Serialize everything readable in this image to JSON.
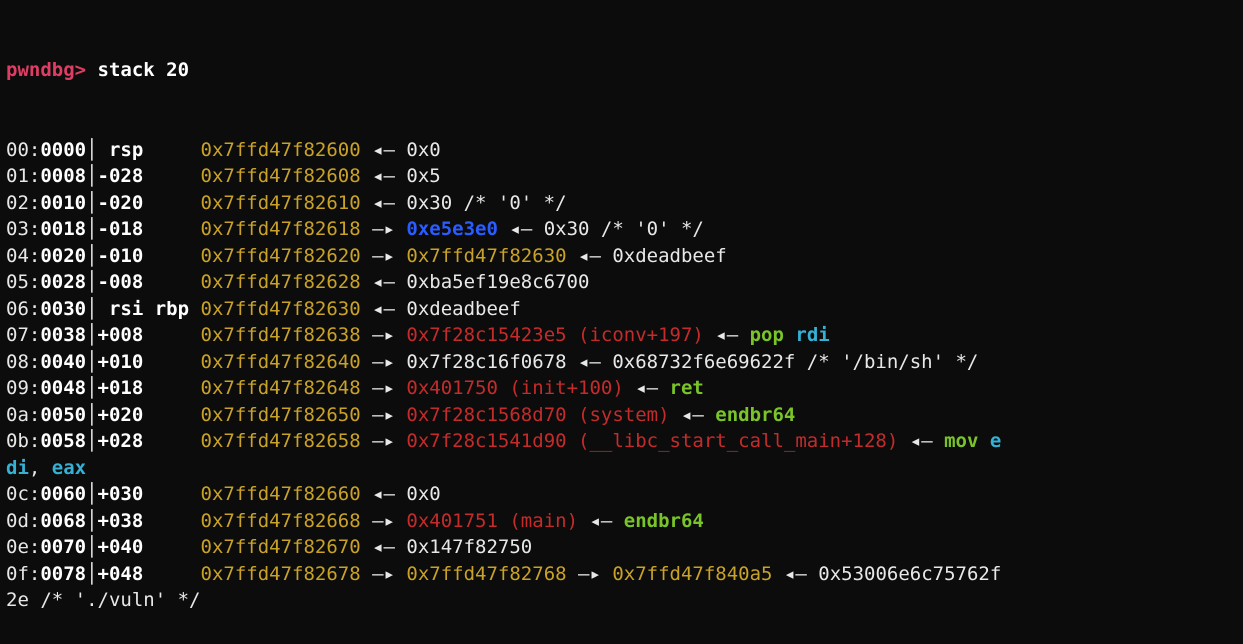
{
  "prompt": "pwndbg>",
  "command": " stack 20",
  "rows": [
    {
      "idx": "00:",
      "off": "0000",
      "delta": " rsp    ",
      "segs": [
        {
          "cls": "c-address",
          "t": " 0x7ffd47f82600"
        },
        {
          "cls": "c-white",
          "t": " ◂— 0x0"
        }
      ]
    },
    {
      "idx": "01:",
      "off": "0008",
      "delta": "-028    ",
      "segs": [
        {
          "cls": "c-address",
          "t": " 0x7ffd47f82608"
        },
        {
          "cls": "c-white",
          "t": " ◂— 0x5"
        }
      ]
    },
    {
      "idx": "02:",
      "off": "0010",
      "delta": "-020    ",
      "segs": [
        {
          "cls": "c-address",
          "t": " 0x7ffd47f82610"
        },
        {
          "cls": "c-white",
          "t": " ◂— 0x30 /* '0' */"
        }
      ]
    },
    {
      "idx": "03:",
      "off": "0018",
      "delta": "-018    ",
      "segs": [
        {
          "cls": "c-address",
          "t": " 0x7ffd47f82618"
        },
        {
          "cls": "c-white",
          "t": " —▸ "
        },
        {
          "cls": "c-blue",
          "t": "0xe5e3e0"
        },
        {
          "cls": "c-white",
          "t": " ◂— 0x30 /* '0' */"
        }
      ]
    },
    {
      "idx": "04:",
      "off": "0020",
      "delta": "-010    ",
      "segs": [
        {
          "cls": "c-address",
          "t": " 0x7ffd47f82620"
        },
        {
          "cls": "c-white",
          "t": " —▸ "
        },
        {
          "cls": "c-address",
          "t": "0x7ffd47f82630"
        },
        {
          "cls": "c-white",
          "t": " ◂— 0xdeadbeef"
        }
      ]
    },
    {
      "idx": "05:",
      "off": "0028",
      "delta": "-008    ",
      "segs": [
        {
          "cls": "c-address",
          "t": " 0x7ffd47f82628"
        },
        {
          "cls": "c-white",
          "t": " ◂— 0xba5ef19e8c6700"
        }
      ]
    },
    {
      "idx": "06:",
      "off": "0030",
      "delta": " rsi rbp",
      "segs": [
        {
          "cls": "c-address",
          "t": " 0x7ffd47f82630"
        },
        {
          "cls": "c-white",
          "t": " ◂— 0xdeadbeef"
        }
      ]
    },
    {
      "idx": "07:",
      "off": "0038",
      "delta": "+008    ",
      "segs": [
        {
          "cls": "c-address",
          "t": " 0x7ffd47f82638"
        },
        {
          "cls": "c-white",
          "t": " —▸ "
        },
        {
          "cls": "c-red",
          "t": "0x7f28c15423e5 (iconv+197)"
        },
        {
          "cls": "c-white",
          "t": " ◂— "
        },
        {
          "cls": "c-green",
          "t": "pop "
        },
        {
          "cls": "c-cyan",
          "t": "rdi"
        }
      ]
    },
    {
      "idx": "08:",
      "off": "0040",
      "delta": "+010    ",
      "segs": [
        {
          "cls": "c-address",
          "t": " 0x7ffd47f82640"
        },
        {
          "cls": "c-white",
          "t": " —▸ 0x7f28c16f0678 ◂— 0x68732f6e69622f /* '/bin/sh' */"
        }
      ]
    },
    {
      "idx": "09:",
      "off": "0048",
      "delta": "+018    ",
      "segs": [
        {
          "cls": "c-address",
          "t": " 0x7ffd47f82648"
        },
        {
          "cls": "c-white",
          "t": " —▸ "
        },
        {
          "cls": "c-red",
          "t": "0x401750 (init+100)"
        },
        {
          "cls": "c-white",
          "t": " ◂— "
        },
        {
          "cls": "c-green",
          "t": "ret"
        }
      ]
    },
    {
      "idx": "0a:",
      "off": "0050",
      "delta": "+020    ",
      "segs": [
        {
          "cls": "c-address",
          "t": " 0x7ffd47f82650"
        },
        {
          "cls": "c-white",
          "t": " —▸ "
        },
        {
          "cls": "c-red",
          "t": "0x7f28c1568d70 (system)"
        },
        {
          "cls": "c-white",
          "t": " ◂— "
        },
        {
          "cls": "c-green",
          "t": "endbr64"
        }
      ]
    },
    {
      "idx": "0b:",
      "off": "0058",
      "delta": "+028    ",
      "segs": [
        {
          "cls": "c-address",
          "t": " 0x7ffd47f82658"
        },
        {
          "cls": "c-white",
          "t": " —▸ "
        },
        {
          "cls": "c-red",
          "t": "0x7f28c1541d90 (__libc_start_call_main+128)"
        },
        {
          "cls": "c-white",
          "t": " ◂— "
        },
        {
          "cls": "c-green",
          "t": "mov "
        },
        {
          "cls": "c-cyan",
          "t": "e"
        }
      ]
    },
    {
      "wrap": true,
      "segs": [
        {
          "cls": "c-cyan",
          "t": "di"
        },
        {
          "cls": "c-white",
          "t": ", "
        },
        {
          "cls": "c-cyan",
          "t": "eax"
        }
      ]
    },
    {
      "idx": "0c:",
      "off": "0060",
      "delta": "+030    ",
      "segs": [
        {
          "cls": "c-address",
          "t": " 0x7ffd47f82660"
        },
        {
          "cls": "c-white",
          "t": " ◂— 0x0"
        }
      ]
    },
    {
      "idx": "0d:",
      "off": "0068",
      "delta": "+038    ",
      "segs": [
        {
          "cls": "c-address",
          "t": " 0x7ffd47f82668"
        },
        {
          "cls": "c-white",
          "t": " —▸ "
        },
        {
          "cls": "c-red",
          "t": "0x401751 (main)"
        },
        {
          "cls": "c-white",
          "t": " ◂— "
        },
        {
          "cls": "c-green",
          "t": "endbr64"
        }
      ]
    },
    {
      "idx": "0e:",
      "off": "0070",
      "delta": "+040    ",
      "segs": [
        {
          "cls": "c-address",
          "t": " 0x7ffd47f82670"
        },
        {
          "cls": "c-white",
          "t": " ◂— 0x147f82750"
        }
      ]
    },
    {
      "idx": "0f:",
      "off": "0078",
      "delta": "+048    ",
      "segs": [
        {
          "cls": "c-address",
          "t": " 0x7ffd47f82678"
        },
        {
          "cls": "c-white",
          "t": " —▸ "
        },
        {
          "cls": "c-address",
          "t": "0x7ffd47f82768"
        },
        {
          "cls": "c-white",
          "t": " —▸ "
        },
        {
          "cls": "c-address",
          "t": "0x7ffd47f840a5"
        },
        {
          "cls": "c-white",
          "t": " ◂— 0x53006e6c75762f"
        }
      ]
    },
    {
      "wrap": true,
      "segs": [
        {
          "cls": "c-white",
          "t": "2e /* './vuln' */"
        }
      ]
    }
  ]
}
